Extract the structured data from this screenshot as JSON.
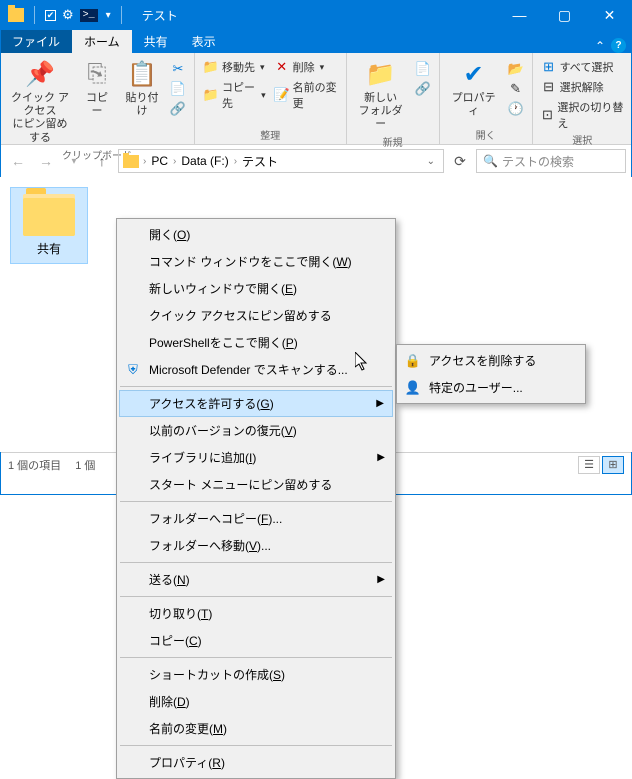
{
  "title": "テスト",
  "tabs": {
    "file": "ファイル",
    "home": "ホーム",
    "share": "共有",
    "view": "表示"
  },
  "ribbon": {
    "clipboard": {
      "label": "クリップボード",
      "quick_access": "クイック アクセス\nにピン留めする",
      "copy": "コピー",
      "paste": "貼り付け"
    },
    "organize": {
      "label": "整理",
      "move_to": "移動先",
      "copy_to": "コピー先",
      "delete": "削除",
      "rename": "名前の変更"
    },
    "new": {
      "label": "新規",
      "new_folder": "新しい\nフォルダー"
    },
    "open": {
      "label": "開く",
      "properties": "プロパティ"
    },
    "select": {
      "label": "選択",
      "select_all": "すべて選択",
      "select_none": "選択解除",
      "select_invert": "選択の切り替え"
    }
  },
  "breadcrumbs": {
    "pc": "PC",
    "drive": "Data (F:)",
    "folder": "テスト"
  },
  "search_placeholder": "テストの検索",
  "item_name": "共有",
  "status": {
    "count": "1 個の項目",
    "selected": "1 個"
  },
  "ctx": {
    "open": "開く(",
    "open_k": "O",
    "close": ")",
    "cmd": "コマンド ウィンドウをここで開く(",
    "cmd_k": "W",
    "newwin": "新しいウィンドウで開く(",
    "newwin_k": "E",
    "pin_qa": "クイック アクセスにピン留めする",
    "ps": "PowerShellをここで開く(",
    "ps_k": "P",
    "defender": "Microsoft Defender でスキャンする...",
    "access": "アクセスを許可する(",
    "access_k": "G",
    "prev_ver": "以前のバージョンの復元(",
    "prev_ver_k": "V",
    "library": "ライブラリに追加(",
    "library_k": "I",
    "pin_start": "スタート メニューにピン留めする",
    "copy_to_f": "フォルダーへコピー(",
    "copy_to_f_k": "F",
    "dots": ")...",
    "move_to_f": "フォルダーへ移動(",
    "move_to_f_k": "V",
    "send_to": "送る(",
    "send_to_k": "N",
    "cut": "切り取り(",
    "cut_k": "T",
    "copy": "コピー(",
    "copy_k": "C",
    "shortcut": "ショートカットの作成(",
    "shortcut_k": "S",
    "del": "削除(",
    "del_k": "D",
    "ren": "名前の変更(",
    "ren_k": "M",
    "prop": "プロパティ(",
    "prop_k": "R"
  },
  "sub": {
    "remove": "アクセスを削除する",
    "users": "特定のユーザー..."
  }
}
